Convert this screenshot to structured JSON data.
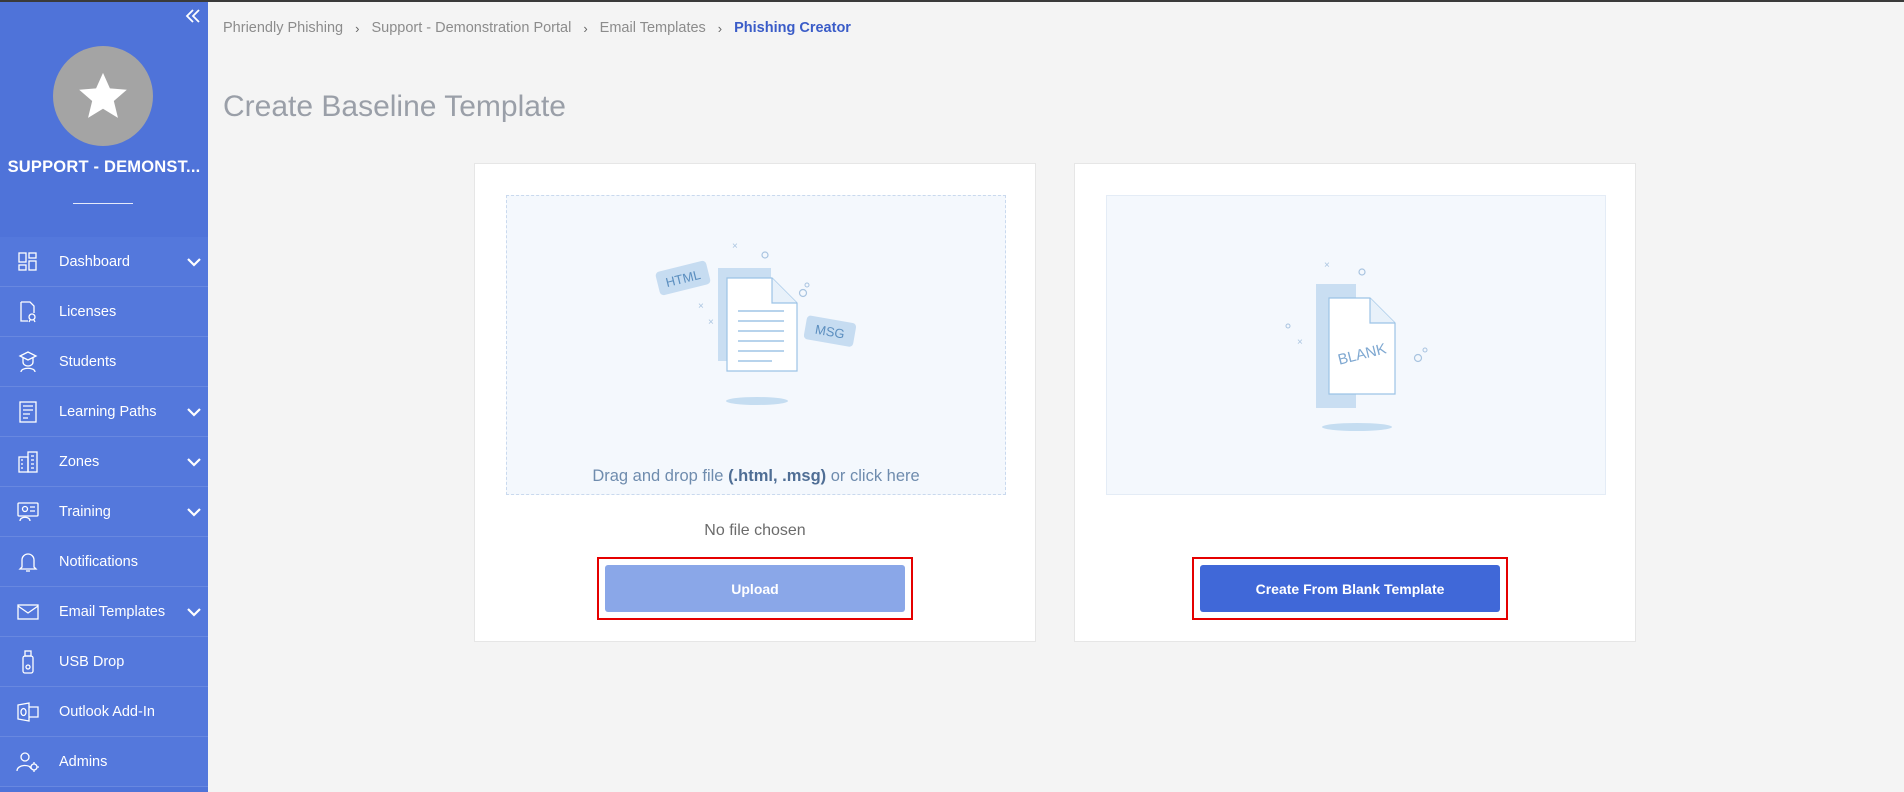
{
  "sidebar": {
    "org_name": "SUPPORT - DEMONST...",
    "items": [
      {
        "label": "Dashboard",
        "icon": "dashboard-icon",
        "expandable": true
      },
      {
        "label": "Licenses",
        "icon": "license-icon",
        "expandable": false
      },
      {
        "label": "Students",
        "icon": "student-icon",
        "expandable": false
      },
      {
        "label": "Learning Paths",
        "icon": "book-icon",
        "expandable": true
      },
      {
        "label": "Zones",
        "icon": "building-icon",
        "expandable": true
      },
      {
        "label": "Training",
        "icon": "training-icon",
        "expandable": true
      },
      {
        "label": "Notifications",
        "icon": "bell-icon",
        "expandable": false
      },
      {
        "label": "Email Templates",
        "icon": "envelope-icon",
        "expandable": true
      },
      {
        "label": "USB Drop",
        "icon": "usb-icon",
        "expandable": false
      },
      {
        "label": "Outlook Add-In",
        "icon": "outlook-icon",
        "expandable": false
      },
      {
        "label": "Admins",
        "icon": "admin-icon",
        "expandable": false
      }
    ]
  },
  "breadcrumb": {
    "items": [
      "Phriendly Phishing",
      "Support - Demonstration Portal",
      "Email Templates"
    ],
    "current": "Phishing Creator",
    "separator": "›"
  },
  "page_title": "Create Baseline Template",
  "upload_card": {
    "dropzone_prefix": "Drag and drop file ",
    "dropzone_ext": "(.html, .msg)",
    "dropzone_suffix": " or click here",
    "tag_html": "HTML",
    "tag_msg": "MSG",
    "file_status": "No file chosen",
    "button_label": "Upload"
  },
  "blank_card": {
    "doc_label": "BLANK",
    "button_label": "Create From Blank Template"
  },
  "colors": {
    "sidebar": "#4f73d9",
    "accent": "#4068d8",
    "highlight_border": "#e50000"
  }
}
